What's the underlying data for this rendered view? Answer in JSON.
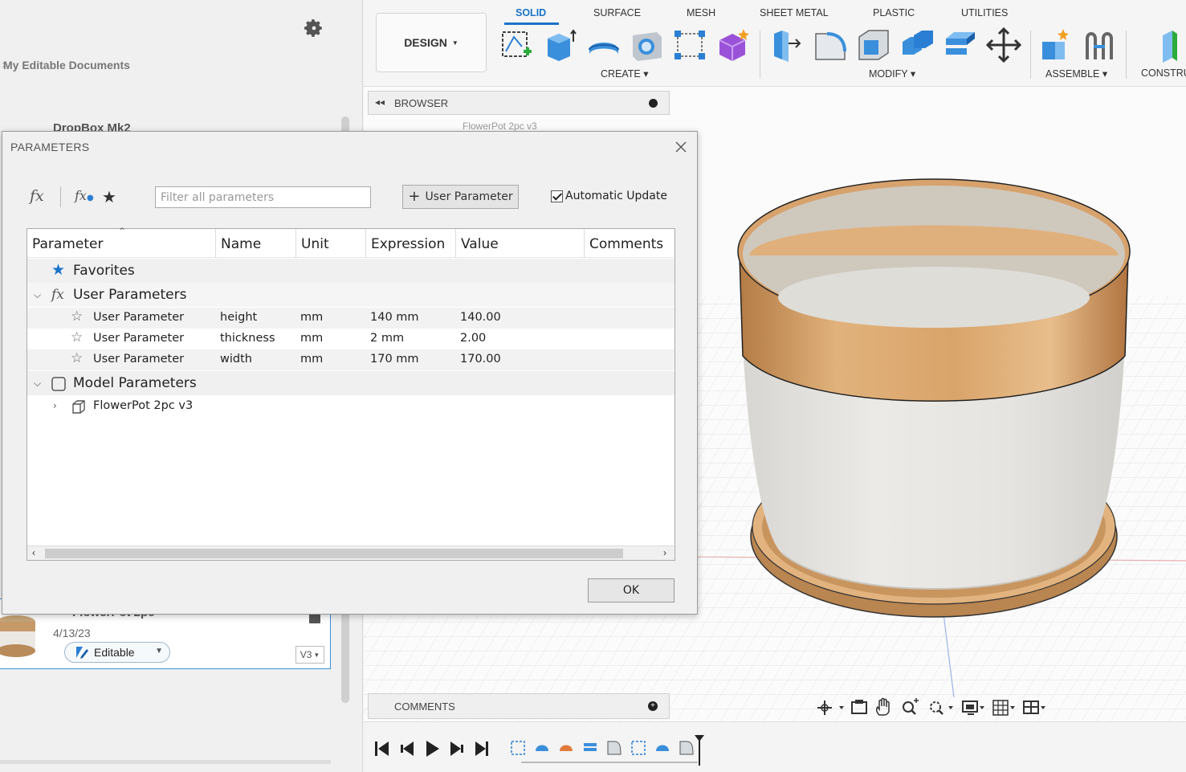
{
  "data_panel": {
    "breadcrumb": "My Editable Documents",
    "item_partial": "DropBox Mk2",
    "card": {
      "title_partial": "FlowerPot 2pc",
      "date": "4/13/23",
      "status": "Editable",
      "version": "V3"
    }
  },
  "toolbar": {
    "workspace": "DESIGN",
    "tabs": [
      "SOLID",
      "SURFACE",
      "MESH",
      "SHEET METAL",
      "PLASTIC",
      "UTILITIES"
    ],
    "active_tab": "SOLID",
    "groups": [
      "CREATE",
      "MODIFY",
      "ASSEMBLE",
      "CONSTRU"
    ]
  },
  "browser": {
    "title": "BROWSER",
    "root_partial": "FlowerPot 2pc v3"
  },
  "comments": {
    "title": "COMMENTS"
  },
  "dialog": {
    "title": "PARAMETERS",
    "filter_placeholder": "Filter all parameters",
    "add_button": "User Parameter",
    "auto_update_label": "Automatic Update",
    "auto_update_checked": true,
    "ok_label": "OK",
    "columns": [
      "Parameter",
      "Name",
      "Unit",
      "Expression",
      "Value",
      "Comments"
    ],
    "groups": {
      "favorites": "Favorites",
      "user": "User Parameters",
      "model": "Model Parameters"
    },
    "user_parameters": [
      {
        "parameter": "User Parameter",
        "name": "height",
        "unit": "mm",
        "expression": "140 mm",
        "value": "140.00"
      },
      {
        "parameter": "User Parameter",
        "name": "thickness",
        "unit": "mm",
        "expression": "2 mm",
        "value": "2.00"
      },
      {
        "parameter": "User Parameter",
        "name": "width",
        "unit": "mm",
        "expression": "170 mm",
        "value": "170.00"
      }
    ],
    "model_component": "FlowerPot 2pc v3"
  },
  "colors": {
    "accent": "#1a73c9",
    "wood": "#d9a46a",
    "pot": "#e7e5e1"
  }
}
